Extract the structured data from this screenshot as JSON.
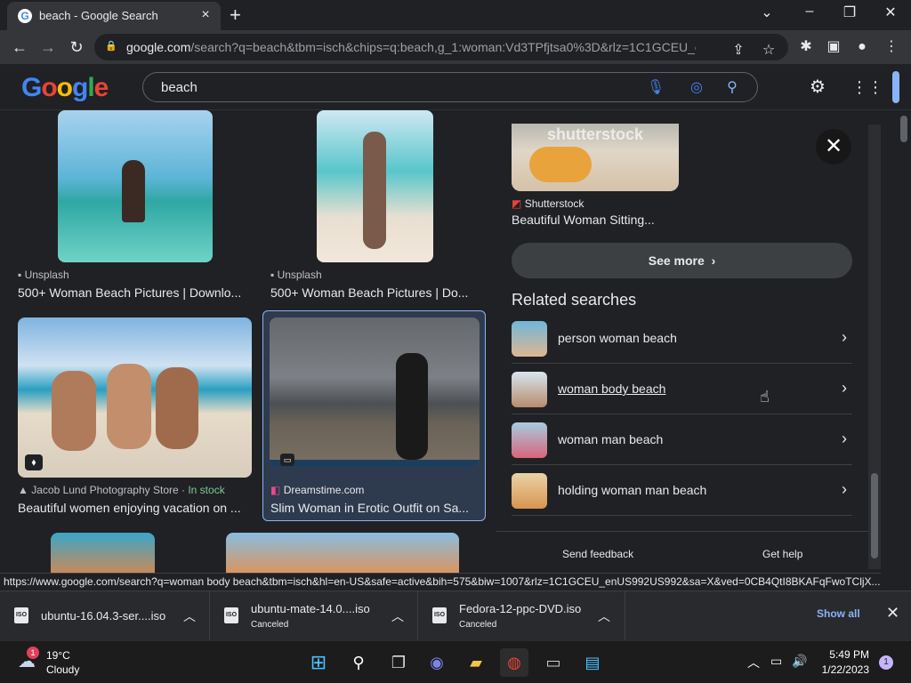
{
  "browser": {
    "tab_title": "beach - Google Search",
    "url_host": "google.com",
    "url_path": "/search?q=beach&tbm=isch&chips=q:beach,g_1:woman:Vd3TPfjtsa0%3D&rlz=1C1GCEU_enUS...",
    "new_tab": "+",
    "min": "⌄",
    "restore": "–",
    "maximize": "❐",
    "close": "✕"
  },
  "google": {
    "logo": "Google",
    "query": "beach"
  },
  "results": [
    {
      "source": "Unsplash",
      "title": "500+ Woman Beach Pictures | Downlo..."
    },
    {
      "source": "Unsplash",
      "title": "500+ Woman Beach Pictures | Do..."
    },
    {
      "source": "Jacob Lund Photography Store",
      "badge": "In stock",
      "title": "Beautiful women enjoying vacation on ..."
    },
    {
      "source": "Dreamstime.com",
      "title": "Slim Woman in Erotic Outfit on Sa..."
    }
  ],
  "panel": {
    "top_source": "Shutterstock",
    "top_title": "Beautiful Woman Sitting...",
    "see_more": "See more",
    "related_heading": "Related searches",
    "related": [
      {
        "label": "person woman beach"
      },
      {
        "label": "woman body beach"
      },
      {
        "label": "woman man beach"
      },
      {
        "label": "holding woman man beach"
      }
    ],
    "send_feedback": "Send feedback",
    "get_help": "Get help"
  },
  "status_url": "https://www.google.com/search?q=woman body beach&tbm=isch&hl=en-US&safe=active&bih=575&biw=1007&rlz=1C1GCEU_enUS992US992&sa=X&ved=0CB4QtI8BKAFqFwoTCljX...",
  "downloads": [
    {
      "name": "ubuntu-16.04.3-ser....iso",
      "status": ""
    },
    {
      "name": "ubuntu-mate-14.0....iso",
      "status": "Canceled"
    },
    {
      "name": "Fedora-12-ppc-DVD.iso",
      "status": "Canceled"
    }
  ],
  "downloads_show_all": "Show all",
  "taskbar": {
    "weather_temp": "19°C",
    "weather_desc": "Cloudy",
    "weather_badge": "1",
    "time": "5:49 PM",
    "date": "1/22/2023",
    "notif_count": "1"
  }
}
